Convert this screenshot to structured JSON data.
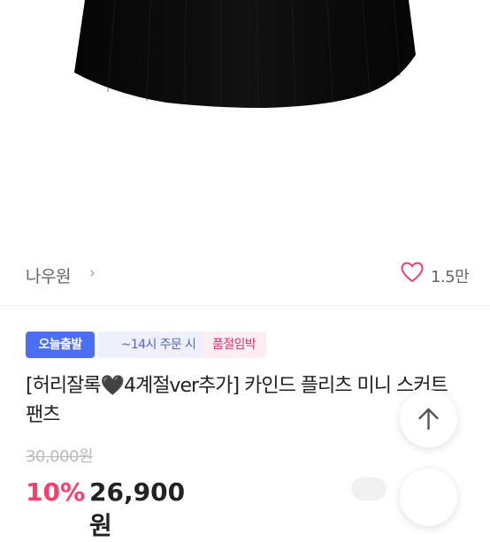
{
  "seller": {
    "name": "나우원",
    "chevron": "›"
  },
  "likes": {
    "count": "1.5만",
    "icon": "heart-outline-icon",
    "color": "#e8416f"
  },
  "badges": {
    "today_shipping": "오늘출발",
    "cutoff": "~14시 주문 시",
    "soldout": "품절임박"
  },
  "product": {
    "title_part1": "[허리잘록",
    "title_emoji": "🖤",
    "title_part2": "4계절ver추가] 카인드 플리츠 미니 스커트 팬츠",
    "original_price": "30,000원",
    "discount": "10%",
    "sale_price": "26,900원"
  },
  "colors": {
    "accent_blue": "#4c6ef5",
    "accent_pink": "#e0346b",
    "discount_red": "#ff3b6b"
  },
  "icons": {
    "scroll_top": "arrow-up-icon"
  }
}
